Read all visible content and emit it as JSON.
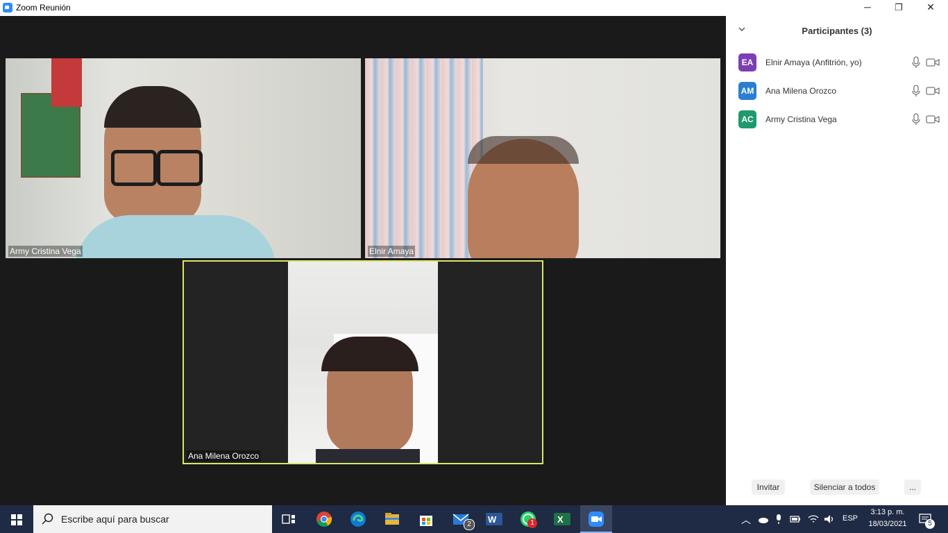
{
  "window": {
    "title": "Zoom Reunión"
  },
  "window_controls": {
    "minimize": "─",
    "restore": "❐",
    "close": "✕"
  },
  "videos": {
    "tile1": {
      "name": "Army Cristina Vega"
    },
    "tile2": {
      "name": "Elnir Amaya"
    },
    "tile3": {
      "name": "Ana Milena Orozco",
      "active_speaker": true
    }
  },
  "participants_panel": {
    "title": "Participantes (3)",
    "items": [
      {
        "initials": "EA",
        "name": "Elnir Amaya (Anfitrión, yo)",
        "color": "#7b3fb3"
      },
      {
        "initials": "AM",
        "name": "Ana Milena Orozco",
        "color": "#2b7fd0"
      },
      {
        "initials": "AC",
        "name": "Army Cristina Vega",
        "color": "#1f9a6e"
      }
    ],
    "buttons": {
      "invite": "Invitar",
      "mute_all": "Silenciar a todos",
      "more": "..."
    }
  },
  "taskbar": {
    "search_placeholder": "Escribe aquí para buscar",
    "mail_badge": "2",
    "whatsapp_badge": "1",
    "language": "ESP",
    "time": "3:13 p. m.",
    "date": "18/03/2021",
    "notifications_badge": "5"
  },
  "colors": {
    "active_speaker_border": "#d9e866",
    "taskbar": "#1f2a44",
    "zoom_blue": "#2d8cff"
  }
}
